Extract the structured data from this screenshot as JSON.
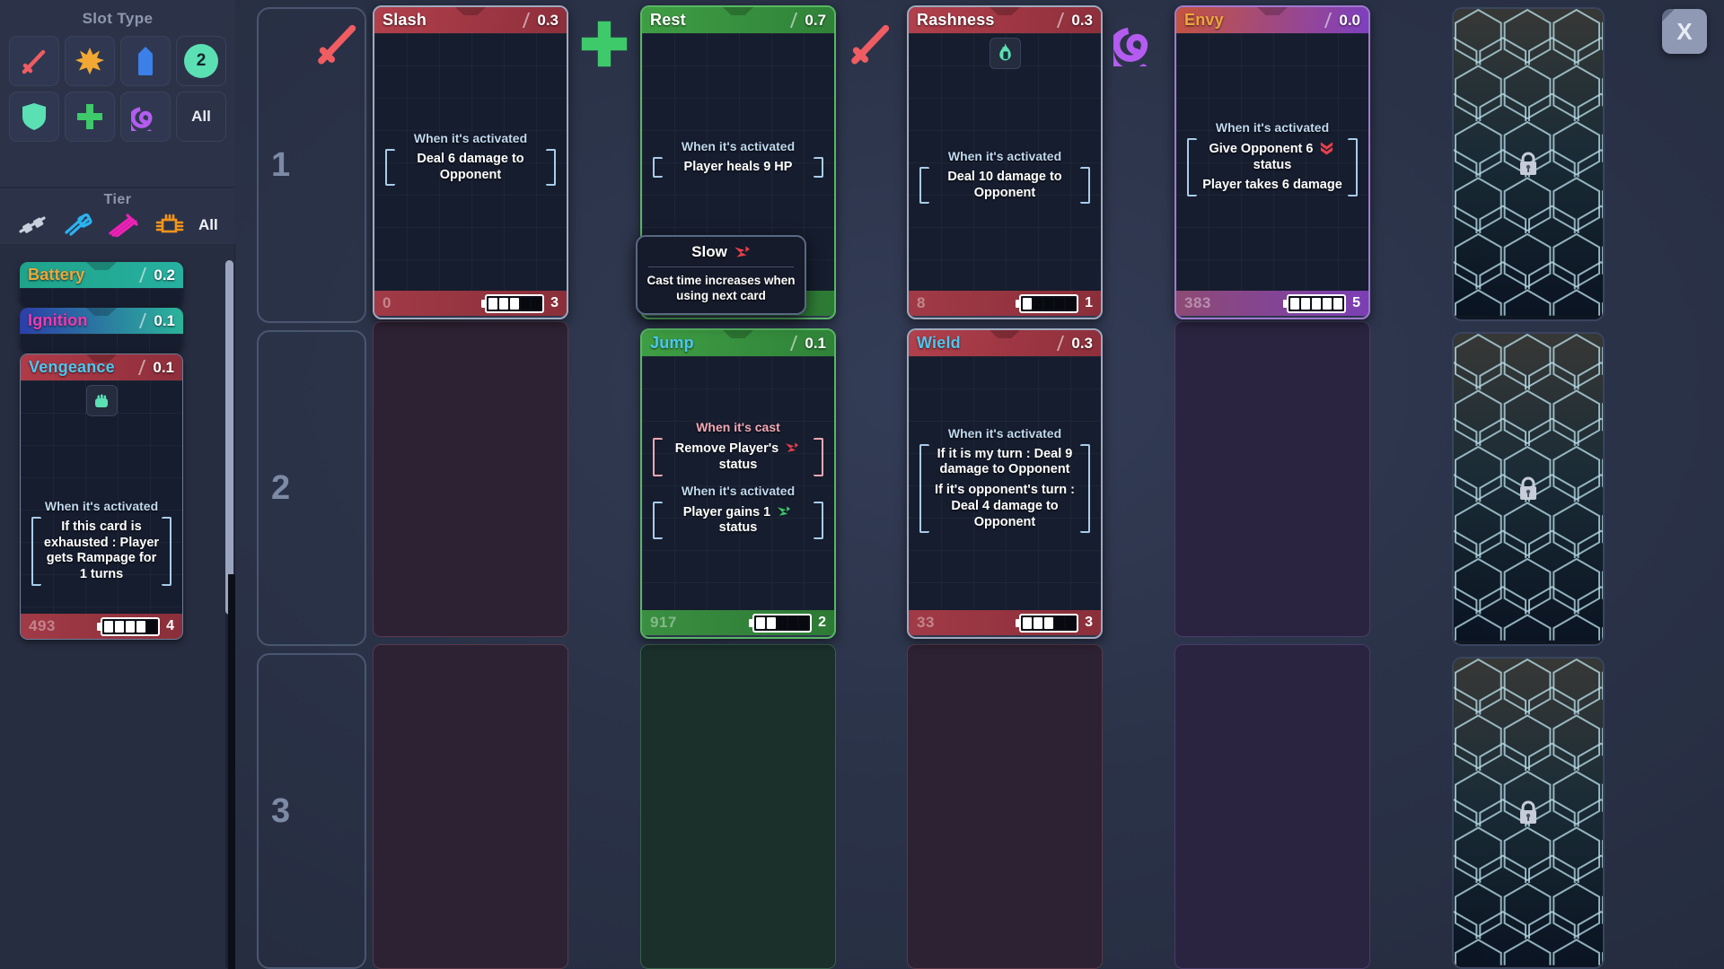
{
  "sidebar": {
    "slot_type": {
      "title": "Slot Type",
      "options": [
        {
          "name": "sword-icon",
          "label": ""
        },
        {
          "name": "burst-icon",
          "label": ""
        },
        {
          "name": "battery-icon",
          "label": ""
        },
        {
          "name": "count-badge",
          "label": "2"
        },
        {
          "name": "shield-icon",
          "label": ""
        },
        {
          "name": "plus-icon",
          "label": ""
        },
        {
          "name": "spiral-icon",
          "label": ""
        },
        {
          "name": "all-filter",
          "label": "All"
        }
      ]
    },
    "tier": {
      "title": "Tier",
      "options": [
        {
          "name": "tier-1-icon",
          "label": ""
        },
        {
          "name": "tier-2-icon",
          "label": ""
        },
        {
          "name": "tier-3-icon",
          "label": ""
        },
        {
          "name": "tier-4-icon",
          "label": ""
        },
        {
          "name": "tier-all",
          "label": "All"
        }
      ]
    },
    "cards": [
      {
        "name": "Battery",
        "cost": "0.2",
        "title_color": "#f0a63c",
        "head_from": "#1fa38a",
        "head_to": "#27b0a0"
      },
      {
        "name": "Ignition",
        "cost": "0.1",
        "title_color": "#f13ab0",
        "head_from": "#2b3fa8",
        "head_to": "#2bb49a"
      },
      {
        "name": "Vengeance",
        "cost": "0.1",
        "title_color": "#4bc8ef",
        "head_from": "#b03a48",
        "head_to": "#8e2f3c",
        "art_icon": "fist-icon",
        "effects": [
          {
            "header": "When it's activated",
            "type": "activated",
            "lines": [
              "If this card is exhausted : Player gets Rampage for 1 turns"
            ]
          }
        ],
        "footer": {
          "id": "493",
          "charge": 4,
          "charge_max": 5,
          "number": "4"
        }
      }
    ]
  },
  "board": {
    "rows": [
      "1",
      "2",
      "3"
    ],
    "lanes": [
      {
        "icon": "sword-icon",
        "icon_color": "#ef5d62"
      },
      {
        "icon": "plus-icon",
        "icon_color": "#3ec96a"
      },
      {
        "icon": "sword-icon",
        "icon_color": "#ef5d62"
      },
      {
        "icon": "spiral-icon",
        "icon_color": "#a84ddb"
      }
    ],
    "cards": [
      {
        "name": "Slash",
        "cost": "0.3",
        "lane": 0,
        "row": 0,
        "title_color": "#ffffff",
        "head_from": "#b1404c",
        "head_to": "#8d2f3b",
        "accent": "#8e323e",
        "effects": [
          {
            "header": "When it's activated",
            "type": "activated",
            "lines": [
              "Deal 6 damage to Opponent"
            ]
          }
        ],
        "footer": {
          "id": "0",
          "charge": 3,
          "charge_max": 5,
          "number": "3"
        }
      },
      {
        "name": "Rest",
        "cost": "0.7",
        "lane": 1,
        "row": 0,
        "title_color": "#ffffff",
        "head_from": "#3f9e44",
        "head_to": "#2f8238",
        "accent": "#2e7a36",
        "effects": [
          {
            "header": "When it's activated",
            "type": "activated",
            "lines": [
              "Player heals 9 HP"
            ]
          }
        ],
        "footer": {
          "id": "",
          "charge": 0,
          "charge_max": 5,
          "number": ""
        }
      },
      {
        "name": "Rashness",
        "cost": "0.3",
        "lane": 2,
        "row": 0,
        "title_color": "#ffffff",
        "head_from": "#b1404c",
        "head_to": "#8d2f3b",
        "accent": "#8e323e",
        "art_icon": "flame-icon",
        "effects": [
          {
            "header": "When it's activated",
            "type": "activated",
            "lines": [
              "Deal 10 damage to Opponent"
            ]
          }
        ],
        "footer": {
          "id": "8",
          "charge": 1,
          "charge_max": 5,
          "number": "1"
        }
      },
      {
        "name": "Envy",
        "cost": "0.0",
        "lane": 3,
        "row": 0,
        "title_color": "#f0a63c",
        "head_from": "#c4543f",
        "head_to": "#7d3fc0",
        "accent": "#6c3b9c",
        "effects": [
          {
            "header": "When it's activated",
            "type": "activated",
            "lines": [
              "Give Opponent 6 %VULN% status",
              "Player takes 6 damage"
            ]
          }
        ],
        "footer": {
          "id": "383",
          "charge": 5,
          "charge_max": 5,
          "number": "5"
        }
      },
      {
        "name": "Jump",
        "cost": "0.1",
        "lane": 1,
        "row": 1,
        "title_color": "#4bc8ef",
        "head_from": "#3f9e44",
        "head_to": "#2f8238",
        "accent": "#2e7a36",
        "effects": [
          {
            "header": "When it's cast",
            "type": "cast",
            "lines": [
              "Remove Player's %SLOW% status"
            ]
          },
          {
            "header": "When it's activated",
            "type": "activated",
            "lines": [
              "Player gains 1 %HASTE% status"
            ]
          }
        ],
        "footer": {
          "id": "917",
          "charge": 2,
          "charge_max": 5,
          "number": "2"
        }
      },
      {
        "name": "Wield",
        "cost": "0.3",
        "lane": 2,
        "row": 1,
        "title_color": "#4bc8ef",
        "head_from": "#b1404c",
        "head_to": "#8d2f3b",
        "accent": "#8e323e",
        "effects": [
          {
            "header": "When it's activated",
            "type": "activated",
            "lines": [
              "If it is my turn : Deal 9 damage to Opponent",
              "If it's opponent's turn : Deal 4 damage to Opponent"
            ]
          }
        ],
        "footer": {
          "id": "33",
          "charge": 3,
          "charge_max": 5,
          "number": "3"
        }
      }
    ],
    "locked_slots": [
      {
        "name": "locked-slot-1",
        "icon": "padlock-icon"
      },
      {
        "name": "locked-slot-2",
        "icon": "padlock-icon"
      },
      {
        "name": "locked-slot-3",
        "icon": "padlock-icon"
      }
    ]
  },
  "tooltip": {
    "title": "Slow",
    "icon": "slow-icon",
    "body": "Cast time increases when using next card"
  },
  "close_button": {
    "label": "X"
  },
  "colors": {
    "red": "#b1404c",
    "green": "#3f9e44",
    "purple": "#7d3fc0",
    "teal": "#4fe0c0",
    "orange": "#f0a63c",
    "cyan": "#4bc8ef",
    "panel": "#2c3349",
    "background": "#2b3349"
  }
}
